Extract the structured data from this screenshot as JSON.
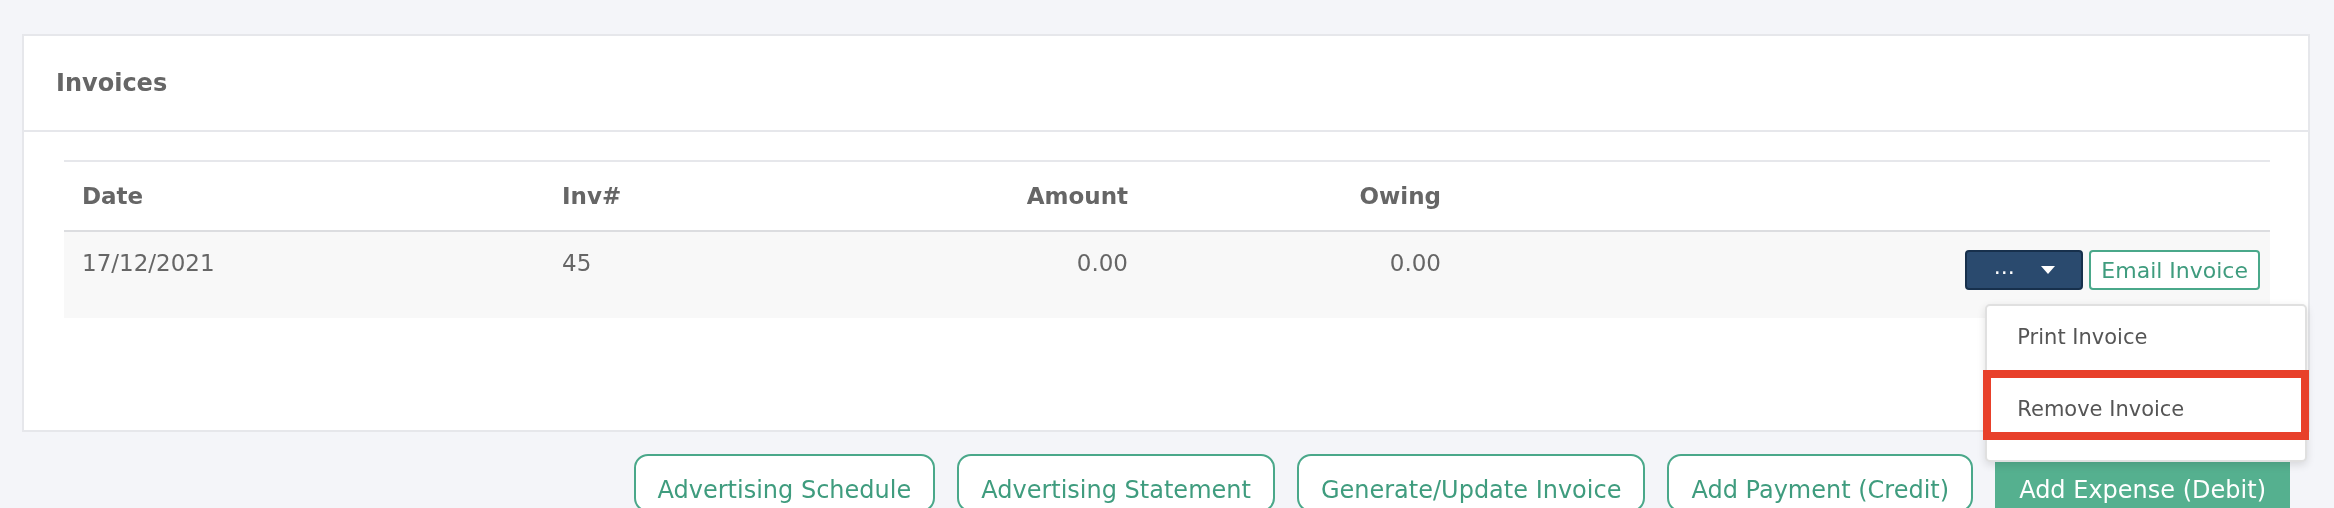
{
  "panel": {
    "title": "Invoices"
  },
  "table": {
    "columns": [
      "Date",
      "Inv#",
      "Amount",
      "Owing"
    ],
    "rows": [
      {
        "cells": [
          "17/12/2021",
          "45",
          "0.00",
          "0.00"
        ],
        "actions": {
          "menu_button": "...",
          "menu_open": true,
          "email_button": "Email Invoice"
        }
      }
    ]
  },
  "menu": {
    "items": [
      {
        "label": "Print Invoice",
        "highlighted": false
      },
      {
        "label": "Remove Invoice",
        "highlighted": true
      }
    ]
  },
  "footer_buttons": [
    {
      "label": "Advertising Schedule",
      "kind": "outline"
    },
    {
      "label": "Advertising Statement",
      "kind": "outline"
    },
    {
      "label": "Generate/Update Invoice",
      "kind": "outline"
    },
    {
      "label": "Add Payment (Credit)",
      "kind": "outline"
    },
    {
      "label": "Add Expense (Debit)",
      "kind": "filled"
    }
  ]
}
